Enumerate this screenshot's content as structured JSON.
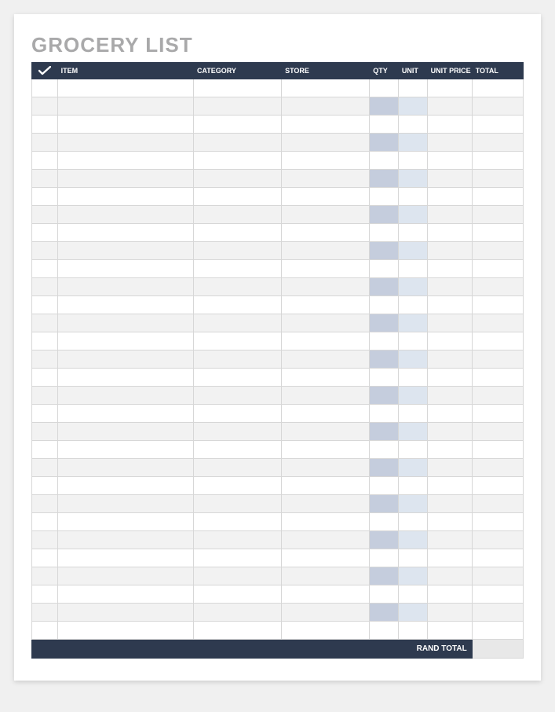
{
  "title": "GROCERY LIST",
  "columns": {
    "check": "",
    "item": "ITEM",
    "category": "CATEGORY",
    "store": "STORE",
    "qty": "QTY",
    "unit": "UNIT",
    "unit_price": "UNIT PRICE",
    "total": "TOTAL"
  },
  "rows": [
    {
      "check": "",
      "item": "",
      "category": "",
      "store": "",
      "qty": "",
      "unit": "",
      "unit_price": "",
      "total": ""
    },
    {
      "check": "",
      "item": "",
      "category": "",
      "store": "",
      "qty": "",
      "unit": "",
      "unit_price": "",
      "total": ""
    },
    {
      "check": "",
      "item": "",
      "category": "",
      "store": "",
      "qty": "",
      "unit": "",
      "unit_price": "",
      "total": ""
    },
    {
      "check": "",
      "item": "",
      "category": "",
      "store": "",
      "qty": "",
      "unit": "",
      "unit_price": "",
      "total": ""
    },
    {
      "check": "",
      "item": "",
      "category": "",
      "store": "",
      "qty": "",
      "unit": "",
      "unit_price": "",
      "total": ""
    },
    {
      "check": "",
      "item": "",
      "category": "",
      "store": "",
      "qty": "",
      "unit": "",
      "unit_price": "",
      "total": ""
    },
    {
      "check": "",
      "item": "",
      "category": "",
      "store": "",
      "qty": "",
      "unit": "",
      "unit_price": "",
      "total": ""
    },
    {
      "check": "",
      "item": "",
      "category": "",
      "store": "",
      "qty": "",
      "unit": "",
      "unit_price": "",
      "total": ""
    },
    {
      "check": "",
      "item": "",
      "category": "",
      "store": "",
      "qty": "",
      "unit": "",
      "unit_price": "",
      "total": ""
    },
    {
      "check": "",
      "item": "",
      "category": "",
      "store": "",
      "qty": "",
      "unit": "",
      "unit_price": "",
      "total": ""
    },
    {
      "check": "",
      "item": "",
      "category": "",
      "store": "",
      "qty": "",
      "unit": "",
      "unit_price": "",
      "total": ""
    },
    {
      "check": "",
      "item": "",
      "category": "",
      "store": "",
      "qty": "",
      "unit": "",
      "unit_price": "",
      "total": ""
    },
    {
      "check": "",
      "item": "",
      "category": "",
      "store": "",
      "qty": "",
      "unit": "",
      "unit_price": "",
      "total": ""
    },
    {
      "check": "",
      "item": "",
      "category": "",
      "store": "",
      "qty": "",
      "unit": "",
      "unit_price": "",
      "total": ""
    },
    {
      "check": "",
      "item": "",
      "category": "",
      "store": "",
      "qty": "",
      "unit": "",
      "unit_price": "",
      "total": ""
    },
    {
      "check": "",
      "item": "",
      "category": "",
      "store": "",
      "qty": "",
      "unit": "",
      "unit_price": "",
      "total": ""
    },
    {
      "check": "",
      "item": "",
      "category": "",
      "store": "",
      "qty": "",
      "unit": "",
      "unit_price": "",
      "total": ""
    },
    {
      "check": "",
      "item": "",
      "category": "",
      "store": "",
      "qty": "",
      "unit": "",
      "unit_price": "",
      "total": ""
    },
    {
      "check": "",
      "item": "",
      "category": "",
      "store": "",
      "qty": "",
      "unit": "",
      "unit_price": "",
      "total": ""
    },
    {
      "check": "",
      "item": "",
      "category": "",
      "store": "",
      "qty": "",
      "unit": "",
      "unit_price": "",
      "total": ""
    },
    {
      "check": "",
      "item": "",
      "category": "",
      "store": "",
      "qty": "",
      "unit": "",
      "unit_price": "",
      "total": ""
    },
    {
      "check": "",
      "item": "",
      "category": "",
      "store": "",
      "qty": "",
      "unit": "",
      "unit_price": "",
      "total": ""
    },
    {
      "check": "",
      "item": "",
      "category": "",
      "store": "",
      "qty": "",
      "unit": "",
      "unit_price": "",
      "total": ""
    },
    {
      "check": "",
      "item": "",
      "category": "",
      "store": "",
      "qty": "",
      "unit": "",
      "unit_price": "",
      "total": ""
    },
    {
      "check": "",
      "item": "",
      "category": "",
      "store": "",
      "qty": "",
      "unit": "",
      "unit_price": "",
      "total": ""
    },
    {
      "check": "",
      "item": "",
      "category": "",
      "store": "",
      "qty": "",
      "unit": "",
      "unit_price": "",
      "total": ""
    },
    {
      "check": "",
      "item": "",
      "category": "",
      "store": "",
      "qty": "",
      "unit": "",
      "unit_price": "",
      "total": ""
    },
    {
      "check": "",
      "item": "",
      "category": "",
      "store": "",
      "qty": "",
      "unit": "",
      "unit_price": "",
      "total": ""
    },
    {
      "check": "",
      "item": "",
      "category": "",
      "store": "",
      "qty": "",
      "unit": "",
      "unit_price": "",
      "total": ""
    },
    {
      "check": "",
      "item": "",
      "category": "",
      "store": "",
      "qty": "",
      "unit": "",
      "unit_price": "",
      "total": ""
    },
    {
      "check": "",
      "item": "",
      "category": "",
      "store": "",
      "qty": "",
      "unit": "",
      "unit_price": "",
      "total": ""
    }
  ],
  "footer": {
    "label": "RAND TOTAL",
    "value": ""
  }
}
